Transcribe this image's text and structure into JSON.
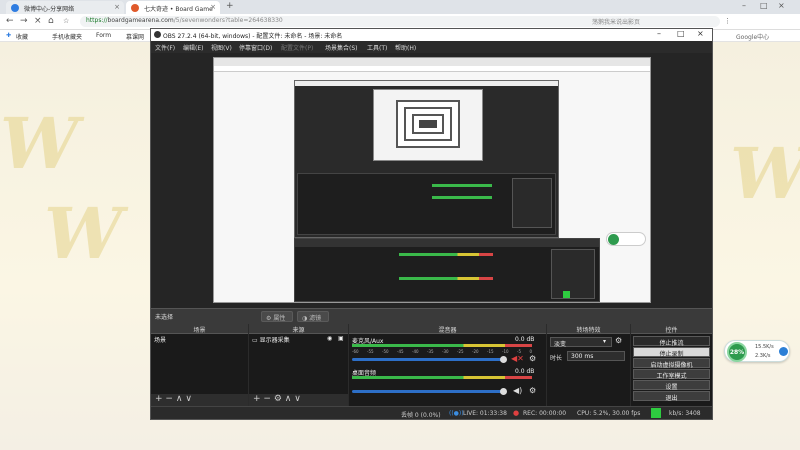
{
  "browser": {
    "tabs": [
      {
        "label": "微博中心-分享网络",
        "active": false,
        "fav_color": "#2f7de1"
      },
      {
        "label": "七大奇迹 • Board Game",
        "active": true,
        "fav_color": "#e05a2b"
      }
    ],
    "new_tab": "+",
    "url_prefix": "https://",
    "url_host": "boardgamearena.com",
    "url_path": "/5/sevenwonders?table=264638330",
    "search_placeholder": "荡鹅我米说出影页",
    "search_box_right": "Google中心",
    "bookmarks": [
      "收藏",
      "手机收藏夹",
      "Form",
      "慕课网"
    ]
  },
  "obs": {
    "title": "OBS 27.2.4 (64-bit, windows) - 配置文件: 未命名 - 场景: 未命名",
    "menu": [
      "文件(F)",
      "编辑(E)",
      "视图(V)",
      "停靠窗口(D)",
      "配置文件(P)",
      "场景集合(S)",
      "工具(T)",
      "帮助(H)"
    ],
    "toolbar": {
      "selection": "未选择",
      "properties": "属性",
      "filters": "滤镜"
    },
    "scenes": {
      "header": "场景",
      "items": [
        "场景"
      ]
    },
    "sources": {
      "header": "来源",
      "items": [
        "显示器采集"
      ]
    },
    "mixer": {
      "header": "混音器",
      "channels": [
        {
          "name": "麦克风/Aux",
          "db": "0.0 dB",
          "muted": true
        },
        {
          "name": "桌面音频",
          "db": "0.0 dB",
          "muted": false
        }
      ],
      "scale": [
        "-60",
        "-55",
        "-50",
        "-45",
        "-40",
        "-35",
        "-30",
        "-25",
        "-20",
        "-15",
        "-10",
        "-5",
        "0"
      ]
    },
    "transitions": {
      "header": "转场特效",
      "type": "淡变",
      "duration_label": "时长",
      "duration_value": "300 ms"
    },
    "controls": {
      "header": "控件",
      "buttons": [
        "停止推流",
        "停止录制",
        "启动虚拟摄像机",
        "工作室模式",
        "设置",
        "退出"
      ]
    },
    "status": {
      "dropped": "丢帧 0 (0.0%)",
      "live": "LIVE: 01:33:38",
      "rec": "REC: 00:00:00",
      "cpu": "CPU: 5.2%, 30.00 fps",
      "bitrate": "kb/s: 3408"
    }
  },
  "widget": {
    "percent": "28%",
    "line1": "15.5K/s",
    "line2": "2.3K/s"
  }
}
